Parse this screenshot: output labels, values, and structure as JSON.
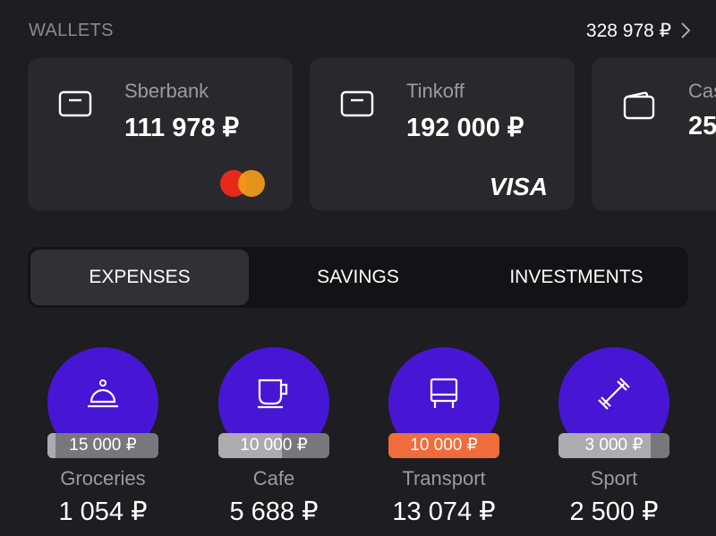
{
  "header": {
    "title": "WALLETS",
    "total": "328 978 ₽"
  },
  "wallets": [
    {
      "name": "Sberbank",
      "balance": "111 978 ₽",
      "icon": "card-icon",
      "brand": "mastercard"
    },
    {
      "name": "Tinkoff",
      "balance": "192 000 ₽",
      "icon": "card-icon",
      "brand": "VISA"
    },
    {
      "name": "Cas",
      "balance": "25",
      "icon": "wallet-icon"
    }
  ],
  "tabs": [
    {
      "label": "EXPENSES",
      "active": true
    },
    {
      "label": "SAVINGS"
    },
    {
      "label": "INVESTMENTS"
    }
  ],
  "categories": [
    {
      "name": "Groceries",
      "amount": "1 054 ₽",
      "budget": "15 000 ₽",
      "progress": 0.07,
      "icon": "cloche-icon",
      "over": false
    },
    {
      "name": "Cafe",
      "amount": "5 688 ₽",
      "budget": "10 000 ₽",
      "progress": 0.57,
      "icon": "cup-icon",
      "over": false
    },
    {
      "name": "Transport",
      "amount": "13 074 ₽",
      "budget": "10 000 ₽",
      "progress": 1,
      "icon": "bus-icon",
      "over": true
    },
    {
      "name": "Sport",
      "amount": "2 500 ₽",
      "budget": "3 000 ₽",
      "progress": 0.83,
      "icon": "dumbbell-icon",
      "over": false
    }
  ],
  "colors": {
    "accent": "#4716d4",
    "over_budget": "#ef6c3c",
    "background": "#1d1d22"
  }
}
